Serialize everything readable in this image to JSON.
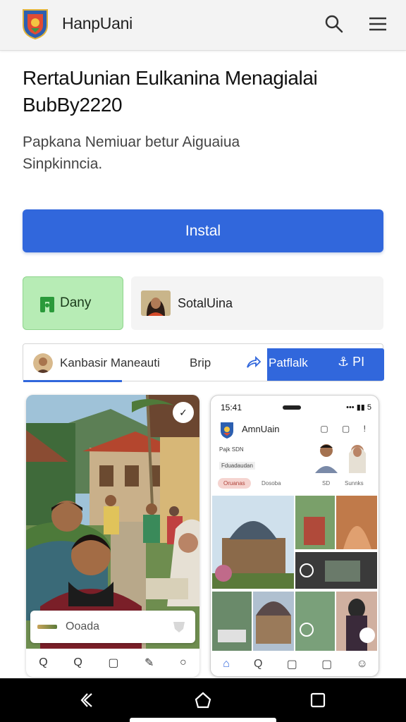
{
  "appbar": {
    "brand": "HanpUani",
    "logo_icon": "crest-shield-icon",
    "search_icon": "search-icon",
    "menu_icon": "hamburger-menu-icon"
  },
  "hero": {
    "headline_line1": "RertaUunian Eulkanina Menagialai",
    "headline_line2": "BubBy2220",
    "subtext_line1": "Papkana Nemiuar betur Aiguaiua",
    "subtext_line2": "Sinpkinncia."
  },
  "install_label": "Instal",
  "chips": {
    "daily_label": "Dany",
    "daily_icon": "green-figure-icon",
    "social_label": "SotalUina"
  },
  "tabbar": {
    "tab1": "Kanbasir Maneauti",
    "tab2": "Brip",
    "share_icon": "share-arrow-icon",
    "tab3": "Patflalk",
    "tab4": "⚓ PI"
  },
  "preview_left": {
    "search_placeholder": "Ooada",
    "nav": [
      "Q",
      "Q",
      "▢",
      "✎",
      "○"
    ],
    "corner_badge": "✓"
  },
  "preview_right": {
    "time": "15:41",
    "signal": "•••  ▮▮ 5",
    "app_title": "AmnUain",
    "mini_icons": "▢ ▢ ! ",
    "tiny_line1": "Pajk SDN",
    "tiny_line2": "Fduadaudan",
    "pills": [
      "Oruanas",
      "Dosoba",
      "SD",
      "Sunnks"
    ],
    "nav": [
      "⌂",
      "Q",
      "▢",
      "▢",
      "☺"
    ]
  },
  "colors": {
    "accent": "#3167dc",
    "chip_green": "#b7ecb5",
    "appbar_bg": "#f3f3f3"
  }
}
